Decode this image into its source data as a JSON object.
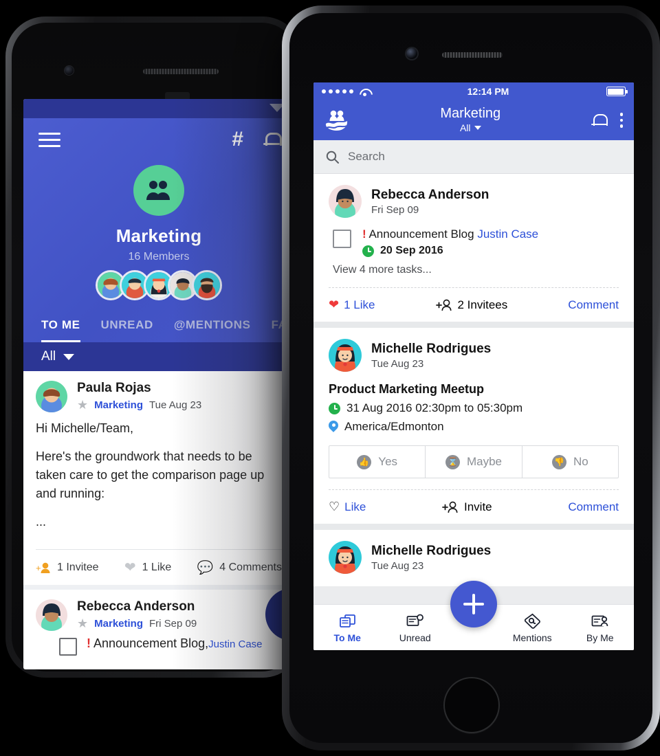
{
  "back_phone": {
    "status_bar": {
      "wifi_icon": "wifi-icon"
    },
    "header": {
      "menu_icon": "hamburger-menu-icon",
      "hash_icon": "hashtag-icon",
      "bell_icon": "bell-icon",
      "group_avatar_icon": "group-people-icon",
      "group_name": "Marketing",
      "members_count": "16 Members"
    },
    "tabs": [
      {
        "label": "TO ME",
        "active": true
      },
      {
        "label": "UNREAD",
        "active": false
      },
      {
        "label": "@MENTIONS",
        "active": false
      },
      {
        "label": "FAVOURITES",
        "active": false
      }
    ],
    "filter": {
      "label": "All",
      "caret_icon": "chevron-down-icon"
    },
    "posts": [
      {
        "author": "Paula Rojas",
        "group": "Marketing",
        "date": "Tue Aug 23",
        "star_icon": "star-icon",
        "body_lines": [
          "Hi Michelle/Team,",
          "Here's the groundwork that needs to be taken care to get the comparison page up and running:",
          "..."
        ],
        "actions": [
          {
            "icon": "add-person-icon",
            "label": "1 Invitee"
          },
          {
            "icon": "heart-icon",
            "label": "1 Like"
          },
          {
            "icon": "comment-icon",
            "label": "4 Comments"
          }
        ]
      },
      {
        "author": "Rebecca Anderson",
        "group": "Marketing",
        "date": "Fri Sep 09",
        "star_icon": "star-icon",
        "task": {
          "checkbox_icon": "checkbox-unchecked-icon",
          "priority_icon": "!",
          "title": "Announcement Blog,",
          "assignee": "Justin Case"
        }
      }
    ]
  },
  "front_phone": {
    "status_bar": {
      "signal_icon": "signal-dots-icon",
      "wifi_icon": "wifi-icon",
      "time": "12:14 PM",
      "battery_icon": "battery-full-icon"
    },
    "nav": {
      "logo_icon": "app-logo-people-waves-icon",
      "title": "Marketing",
      "subtitle": "All",
      "subtitle_caret_icon": "chevron-down-icon",
      "bell_icon": "bell-icon",
      "overflow_icon": "kebab-menu-icon"
    },
    "search": {
      "icon": "search-icon",
      "placeholder": "Search",
      "value": ""
    },
    "cards": [
      {
        "type": "task",
        "author": "Rebecca Anderson",
        "date": "Fri Sep 09",
        "checkbox_icon": "checkbox-unchecked-icon",
        "priority_icon": "!",
        "task_title": "Announcement Blog",
        "task_assignee": "Justin Case",
        "due_icon": "clock-icon",
        "due_date": "20 Sep 2016",
        "more_tasks": "View 4 more tasks...",
        "actions": {
          "like": {
            "icon": "heart-filled-icon",
            "label": "1 Like",
            "liked": true
          },
          "invite": {
            "icon": "add-person-icon",
            "label": "2 Invitees"
          },
          "comment": {
            "label": "Comment"
          }
        }
      },
      {
        "type": "event",
        "author": "Michelle Rodrigues",
        "date": "Tue Aug 23",
        "event_title": "Product Marketing Meetup",
        "time_icon": "clock-icon",
        "event_time": "31 Aug 2016 02:30pm to 05:30pm",
        "location_icon": "location-pin-icon",
        "event_location": "America/Edmonton",
        "rsvp": [
          {
            "icon": "thumbs-up-icon",
            "glyph": "☝",
            "label": "Yes"
          },
          {
            "icon": "hourglass-icon",
            "glyph": "⧗",
            "label": "Maybe"
          },
          {
            "icon": "thumbs-down-icon",
            "glyph": "☟",
            "label": "No"
          }
        ],
        "actions": {
          "like": {
            "icon": "heart-outline-icon",
            "label": "Like",
            "liked": false
          },
          "invite": {
            "icon": "add-person-icon",
            "label": "Invite"
          },
          "comment": {
            "label": "Comment"
          }
        }
      },
      {
        "type": "partial",
        "author": "Michelle Rodrigues",
        "date": "Tue Aug 23"
      }
    ],
    "tabbar": [
      {
        "label": "To Me",
        "icon": "cards-stack-icon",
        "active": true
      },
      {
        "label": "Unread",
        "icon": "unread-message-icon",
        "active": false
      },
      {
        "label": "Mentions",
        "icon": "at-mention-icon",
        "active": false
      },
      {
        "label": "By Me",
        "icon": "by-me-person-icon",
        "active": false
      }
    ],
    "fab": {
      "icon": "plus-icon",
      "label": ""
    }
  },
  "colors": {
    "brand_blue": "#4158ce",
    "dark_indigo": "#2c3695",
    "accent_link": "#2d50d8",
    "fab_blue": "#4458d0",
    "green_avatar": "#56cf96",
    "like_red": "#ef3b3b",
    "clock_green": "#23b14c",
    "pin_blue": "#3b9ae8"
  }
}
